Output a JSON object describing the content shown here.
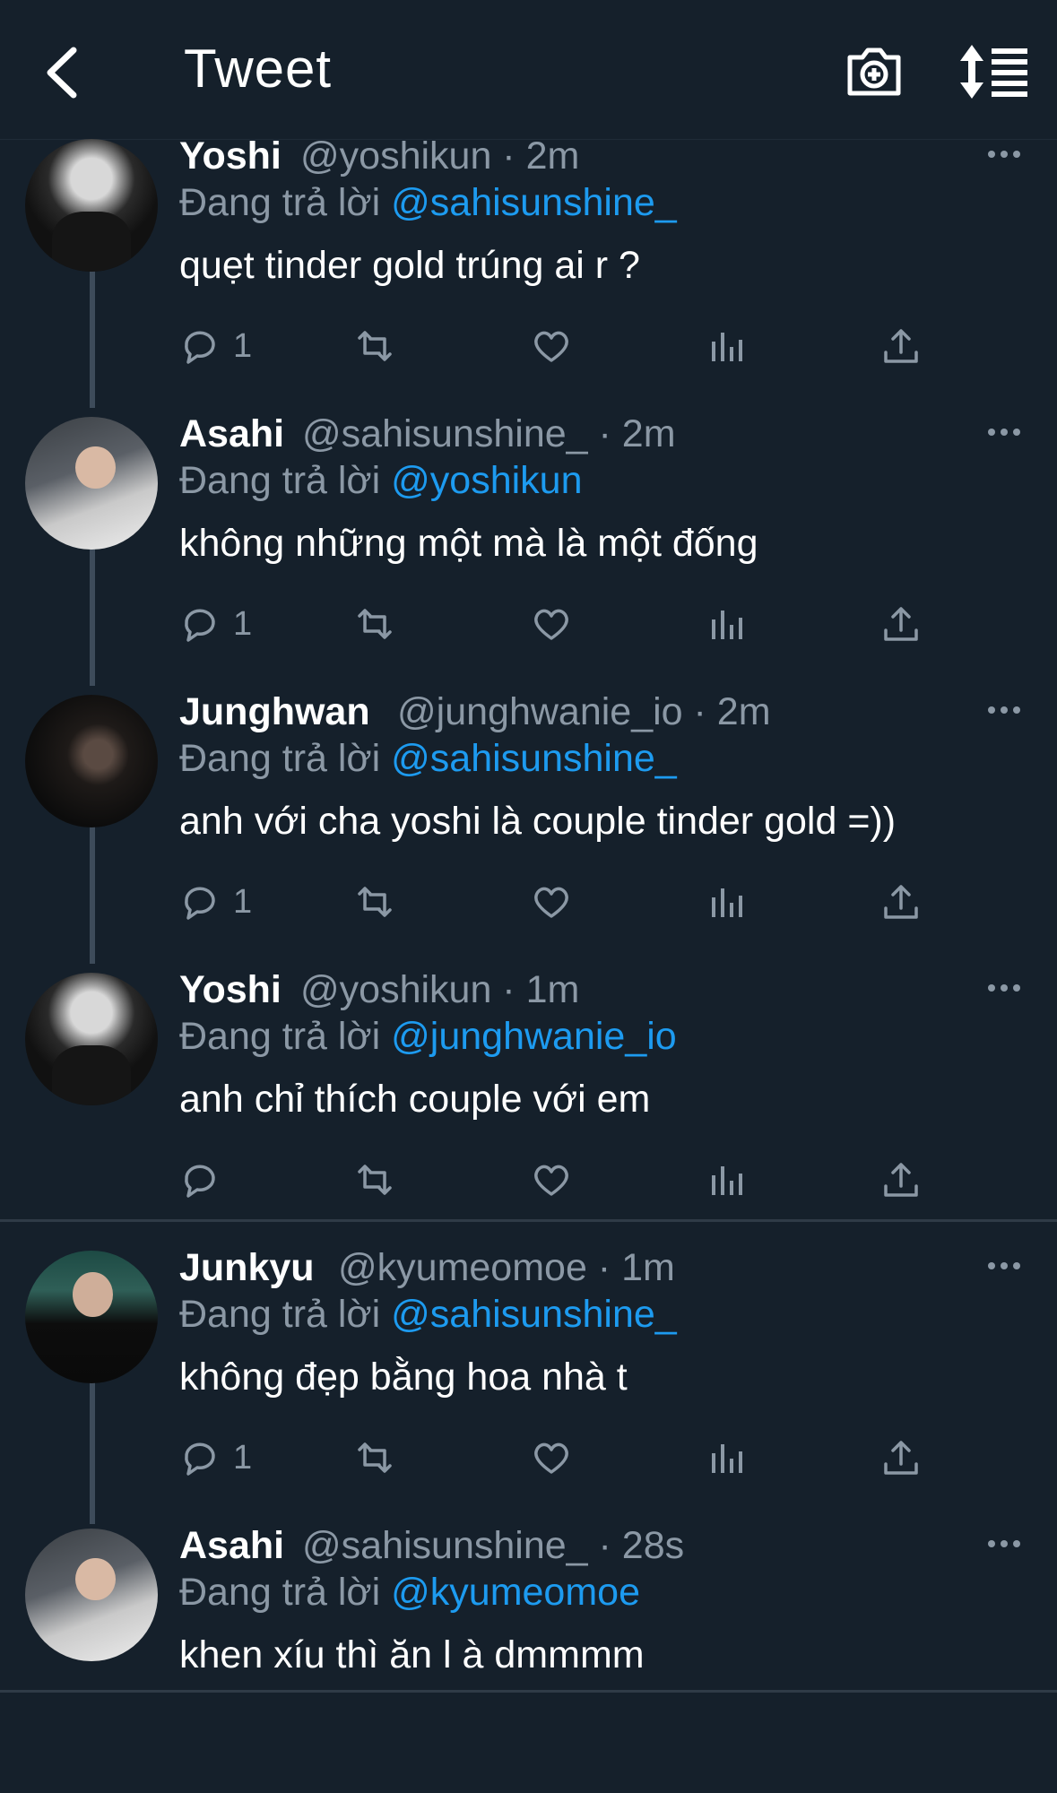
{
  "header": {
    "title": "Tweet",
    "back_icon": "chevron-left-icon",
    "camera_icon": "camera-add-icon",
    "sort_icon": "sort-icon"
  },
  "colors": {
    "background": "#15202b",
    "mention": "#1d9bf0",
    "muted": "#8b98a5"
  },
  "tweets": [
    {
      "name": "Yoshi",
      "meta": "@yoshikun · 2m",
      "reply_prefix": "Đang trả lời ",
      "reply_to": "@sahisunshine_",
      "text": "quẹt tinder gold trúng ai r ?",
      "reply_count": "1"
    },
    {
      "name": "Asahi",
      "meta": "@sahisunshine_ · 2m",
      "reply_prefix": "Đang trả lời ",
      "reply_to": "@yoshikun",
      "text": "không những một mà là một đống",
      "reply_count": "1"
    },
    {
      "name": "Junghwan",
      "meta": "@junghwanie_io · 2m",
      "reply_prefix": "Đang trả lời ",
      "reply_to": "@sahisunshine_",
      "text": "anh với cha yoshi là couple tinder gold =))",
      "reply_count": "1"
    },
    {
      "name": "Yoshi",
      "meta": "@yoshikun · 1m",
      "reply_prefix": "Đang trả lời ",
      "reply_to": "@junghwanie_io",
      "text": "anh chỉ thích couple với em",
      "reply_count": ""
    },
    {
      "name": "Junkyu",
      "meta": "@kyumeomoe · 1m",
      "reply_prefix": "Đang trả lời ",
      "reply_to": "@sahisunshine_",
      "text": "không đẹp bằng hoa nhà t",
      "reply_count": "1"
    },
    {
      "name": "Asahi",
      "meta": "@sahisunshine_ · 28s",
      "reply_prefix": "Đang trả lời ",
      "reply_to": "@kyumeomoe",
      "text": "khen xíu thì ăn l à dmmmm",
      "reply_count": ""
    }
  ]
}
